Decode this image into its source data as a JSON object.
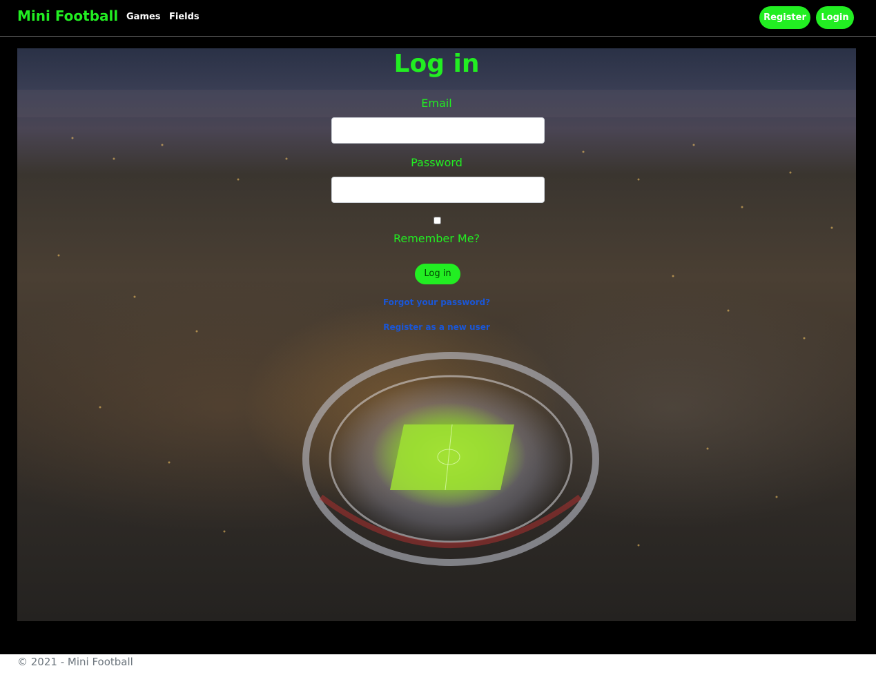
{
  "navbar": {
    "brand": "Mini Football",
    "links": {
      "games": "Games",
      "fields": "Fields"
    },
    "register_label": "Register",
    "login_label": "Login"
  },
  "login_form": {
    "title": "Log in",
    "email_label": "Email",
    "email_value": "",
    "password_label": "Password",
    "password_value": "",
    "remember_me_label": "Remember Me?",
    "remember_me_checked": false,
    "submit_label": "Log in",
    "forgot_password_link": "Forgot your password?",
    "register_link": "Register as a new user"
  },
  "footer": {
    "text": "© 2021 - Mini Football"
  },
  "colors": {
    "accent": "#22ee22",
    "link": "#1a56d6",
    "navbar_bg": "#000000",
    "footer_text": "#6c757d"
  }
}
